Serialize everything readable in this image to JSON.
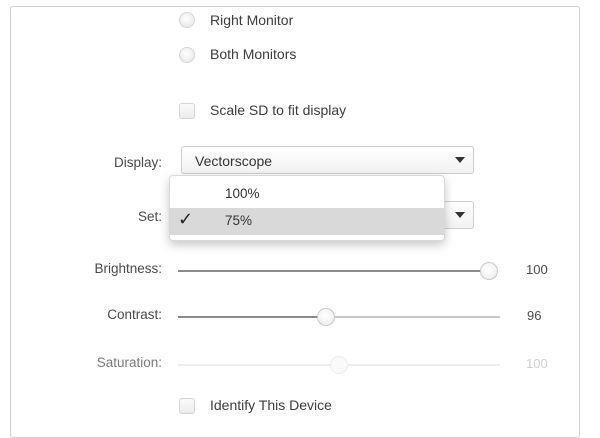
{
  "options": {
    "right_monitor": "Right Monitor",
    "both_monitors": "Both Monitors",
    "scale_sd": "Scale SD to fit display"
  },
  "display": {
    "label": "Display:",
    "value": "Vectorscope"
  },
  "set": {
    "label": "Set:",
    "menu_items": [
      {
        "label": "100%",
        "selected": false
      },
      {
        "label": "75%",
        "selected": true
      }
    ]
  },
  "sliders": {
    "brightness": {
      "label": "Brightness:",
      "value": "100",
      "level": 1.0
    },
    "contrast": {
      "label": "Contrast:",
      "value": "96",
      "level": 0.48
    },
    "saturation": {
      "label": "Saturation:",
      "value": "100",
      "level": 0.5,
      "disabled": true
    }
  },
  "identify": {
    "label": "Identify This Device"
  },
  "icons": {
    "check": "checkmark-icon",
    "dropdown": "chevron-down-icon"
  }
}
